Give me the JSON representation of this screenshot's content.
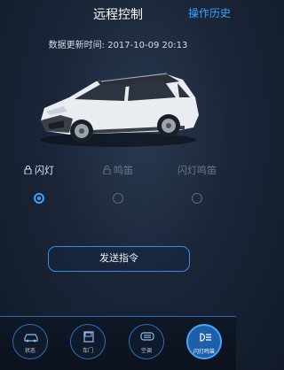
{
  "header": {
    "title": "远程控制",
    "history_label": "操作历史"
  },
  "update_time": "数据更新时间: 2017-10-09 20:13",
  "options": [
    {
      "label": "闪灯",
      "selected": true
    },
    {
      "label": "鸣笛",
      "selected": false
    },
    {
      "label": "闪灯鸣笛",
      "selected": false
    }
  ],
  "send_button": "发送指令",
  "tabs": [
    {
      "label": "状态",
      "icon": "car-icon"
    },
    {
      "label": "车门",
      "icon": "door-icon"
    },
    {
      "label": "空调",
      "icon": "ac-icon"
    },
    {
      "label": "闪灯鸣笛",
      "icon": "headlight-icon",
      "active": true
    }
  ],
  "colors": {
    "accent": "#3aa3ff",
    "background": "#1a2538"
  }
}
